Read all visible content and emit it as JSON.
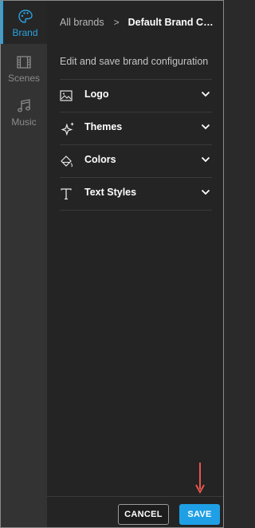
{
  "rail": {
    "items": [
      {
        "label": "Brand",
        "icon": "palette-icon",
        "active": true
      },
      {
        "label": "Scenes",
        "icon": "film-icon",
        "active": false
      },
      {
        "label": "Music",
        "icon": "music-note-icon",
        "active": false
      }
    ]
  },
  "breadcrumb": {
    "root": "All brands",
    "separator": ">",
    "current": "Default Brand Confi..."
  },
  "subtitle": "Edit and save brand configuration",
  "sections": [
    {
      "label": "Logo",
      "icon": "image-icon"
    },
    {
      "label": "Themes",
      "icon": "sparkle-icon"
    },
    {
      "label": "Colors",
      "icon": "paint-bucket-icon"
    },
    {
      "label": "Text Styles",
      "icon": "text-icon"
    }
  ],
  "footer": {
    "cancel_label": "CANCEL",
    "save_label": "SAVE"
  },
  "colors": {
    "accent": "#29a3e0",
    "save_button": "#1fa0e6",
    "annotation_arrow": "#e8554e"
  }
}
